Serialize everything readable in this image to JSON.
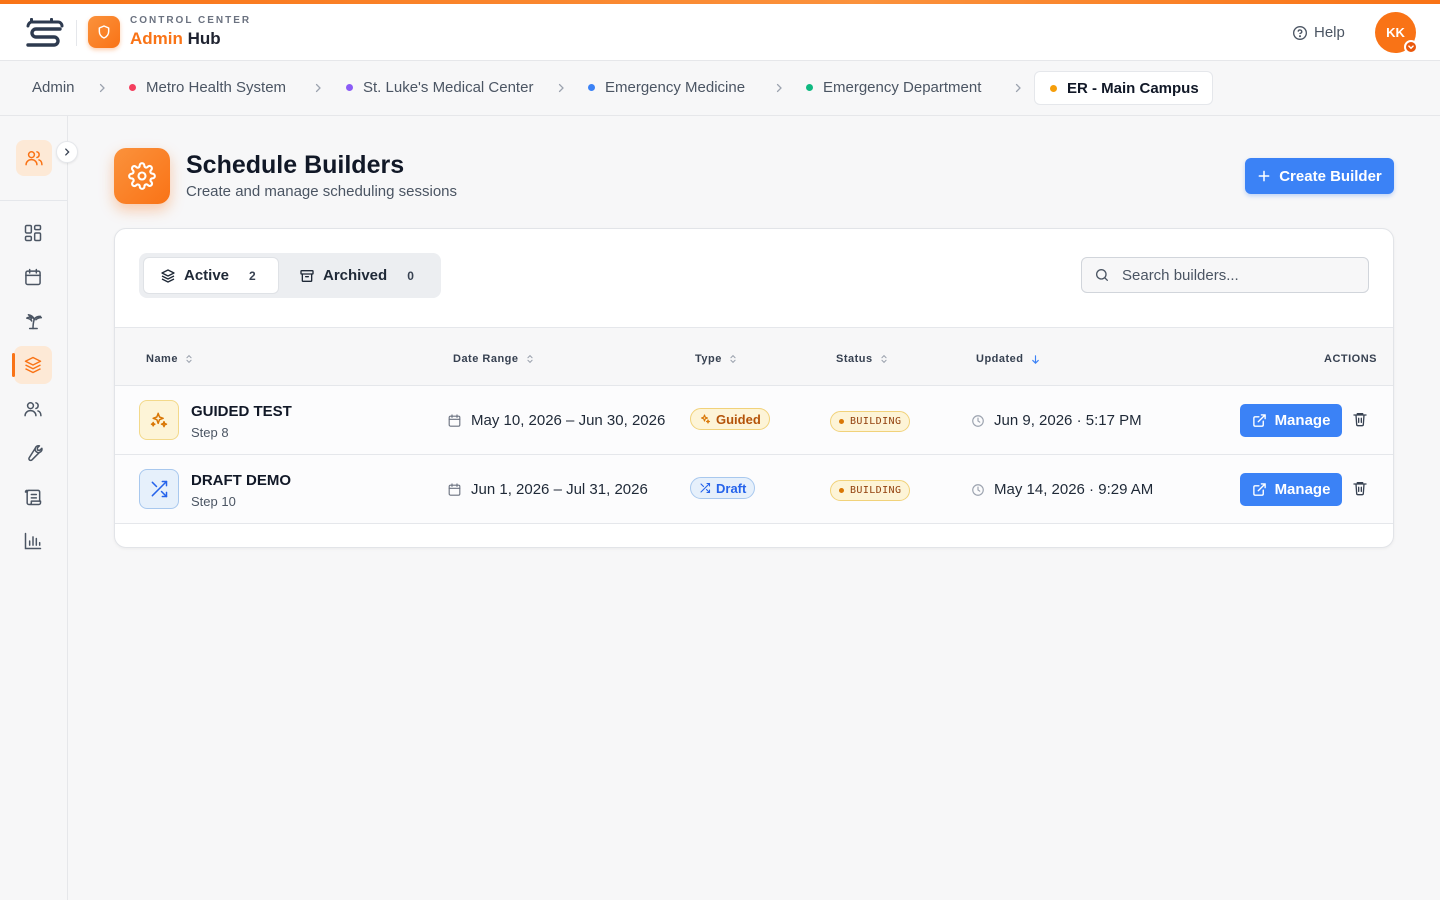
{
  "header": {
    "subtitle": "CONTROL CENTER",
    "title_a": "Admin",
    "title_b": "Hub",
    "help_label": "Help",
    "avatar_initials": "KK"
  },
  "breadcrumb": [
    {
      "label": "Admin",
      "color": ""
    },
    {
      "label": "Metro Health System",
      "color": "#f43f5e"
    },
    {
      "label": "St. Luke's Medical Center",
      "color": "#8b5cf6"
    },
    {
      "label": "Emergency Medicine",
      "color": "#3b82f6"
    },
    {
      "label": "Emergency Department",
      "color": "#10b981"
    },
    {
      "label": "ER - Main Campus",
      "color": "#f59e0b"
    }
  ],
  "sidebar": {
    "icons": [
      "users-icon",
      "dashboard-icon",
      "calendar-icon",
      "palm-tree-icon",
      "layers-icon",
      "users-icon",
      "wrench-icon",
      "scroll-icon",
      "bar-chart-icon"
    ],
    "active": "layers-icon"
  },
  "page": {
    "title": "Schedule Builders",
    "subtitle": "Create and manage scheduling sessions",
    "create_label": "Create Builder"
  },
  "tabs": [
    {
      "label": "Active",
      "count": "2"
    },
    {
      "label": "Archived",
      "count": "0"
    }
  ],
  "search": {
    "placeholder": "Search builders..."
  },
  "table": {
    "columns": {
      "name": "Name",
      "date_range": "Date Range",
      "type": "Type",
      "status": "Status",
      "updated": "Updated",
      "actions": "ACTIONS"
    },
    "rows": [
      {
        "name": "GUIDED TEST",
        "step": "Step 8",
        "date_range": "May 10, 2026 – Jun 30, 2026",
        "type": "Guided",
        "status": "BUILDING",
        "updated": "Jun 9, 2026 · 5:17 PM",
        "action": "Manage"
      },
      {
        "name": "DRAFT DEMO",
        "step": "Step 10",
        "date_range": "Jun 1, 2026 – Jul 31, 2026",
        "type": "Draft",
        "status": "BUILDING",
        "updated": "May 14, 2026 · 9:29 AM",
        "action": "Manage"
      }
    ]
  },
  "colors": {
    "accent": "#f97316",
    "primary": "#3b82f6",
    "guided": "#f59e0b",
    "draft": "#2563eb"
  }
}
